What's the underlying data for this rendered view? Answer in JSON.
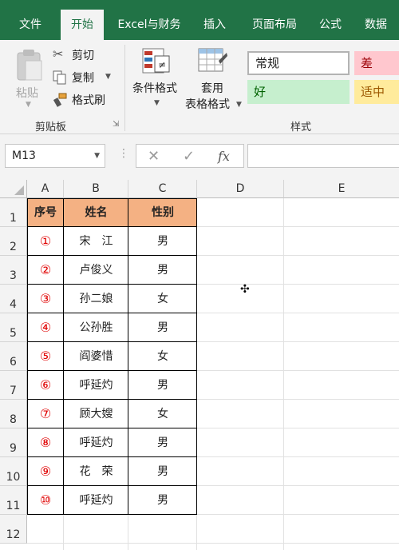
{
  "ribbon_tabs": [
    {
      "label": "文件",
      "active": false
    },
    {
      "label": "开始",
      "active": true
    },
    {
      "label": "Excel与财务",
      "active": false
    },
    {
      "label": "插入",
      "active": false
    },
    {
      "label": "页面布局",
      "active": false
    },
    {
      "label": "公式",
      "active": false
    },
    {
      "label": "数据",
      "active": false
    }
  ],
  "clipboard": {
    "paste": "粘贴",
    "cut": "剪切",
    "copy": "复制",
    "format_painter": "格式刷",
    "group_label": "剪贴板"
  },
  "styles": {
    "conditional_format": "条件格式",
    "table_format_line1": "套用",
    "table_format_line2": "表格格式",
    "group_label": "样式",
    "cell_styles": [
      {
        "label": "常规",
        "bg": "#ffffff",
        "fg": "#222222"
      },
      {
        "label": "差",
        "bg": "#ffc7ce",
        "fg": "#9c0006"
      },
      {
        "label": "好",
        "bg": "#c6efce",
        "fg": "#006100"
      },
      {
        "label": "适中",
        "bg": "#ffeb9c",
        "fg": "#9c5700"
      }
    ]
  },
  "formula_bar": {
    "name_box": "M13",
    "cancel_icon": "✕",
    "enter_icon": "✓",
    "fx_label": "fx",
    "formula": ""
  },
  "columns": [
    "A",
    "B",
    "C",
    "D",
    "E"
  ],
  "rows": [
    "1",
    "2",
    "3",
    "4",
    "5",
    "6",
    "7",
    "8",
    "9",
    "10",
    "11",
    "12"
  ],
  "table": {
    "headers": [
      "序号",
      "姓名",
      "性别"
    ],
    "header_bg": "#f4b183",
    "number_color": "#e00000",
    "records": [
      [
        "①",
        "宋　江",
        "男"
      ],
      [
        "②",
        "卢俊义",
        "男"
      ],
      [
        "③",
        "孙二娘",
        "女"
      ],
      [
        "④",
        "公孙胜",
        "男"
      ],
      [
        "⑤",
        "阎婆惜",
        "女"
      ],
      [
        "⑥",
        "呼延灼",
        "男"
      ],
      [
        "⑦",
        "顾大嫂",
        "女"
      ],
      [
        "⑧",
        "呼延灼",
        "男"
      ],
      [
        "⑨",
        "花　荣",
        "男"
      ],
      [
        "⑩",
        "呼延灼",
        "男"
      ]
    ]
  },
  "accent_color": "#217346"
}
